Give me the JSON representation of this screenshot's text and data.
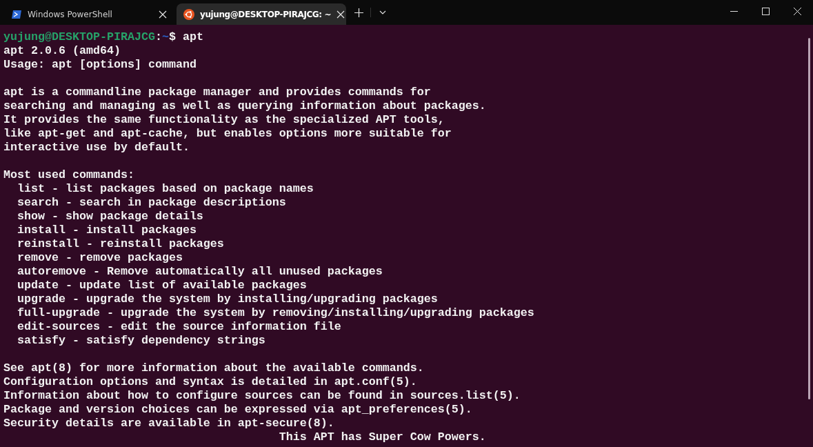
{
  "tabs": [
    {
      "kind": "powershell",
      "title": "Windows PowerShell",
      "selected": false
    },
    {
      "kind": "ubuntu",
      "title": "yujung@DESKTOP-PIRAJCG: ~",
      "selected": true
    }
  ],
  "terminal": {
    "prompt": {
      "user_host": "yujung@DESKTOP-PIRAJCG",
      "separator": ":",
      "path": "~",
      "symbol": "$",
      "command": "apt"
    },
    "blocks": [
      [
        "apt 2.0.6 (amd64)",
        "Usage: apt [options] command"
      ],
      [
        "apt is a commandline package manager and provides commands for",
        "searching and managing as well as querying information about packages.",
        "It provides the same functionality as the specialized APT tools,",
        "like apt-get and apt-cache, but enables options more suitable for",
        "interactive use by default."
      ],
      [
        "Most used commands:",
        "  list - list packages based on package names",
        "  search - search in package descriptions",
        "  show - show package details",
        "  install - install packages",
        "  reinstall - reinstall packages",
        "  remove - remove packages",
        "  autoremove - Remove automatically all unused packages",
        "  update - update list of available packages",
        "  upgrade - upgrade the system by installing/upgrading packages",
        "  full-upgrade - upgrade the system by removing/installing/upgrading packages",
        "  edit-sources - edit the source information file",
        "  satisfy - satisfy dependency strings"
      ],
      [
        "See apt(8) for more information about the available commands.",
        "Configuration options and syntax is detailed in apt.conf(5).",
        "Information about how to configure sources can be found in sources.list(5).",
        "Package and version choices can be expressed via apt_preferences(5).",
        "Security details are available in apt-secure(8).",
        "                                        This APT has Super Cow Powers."
      ]
    ]
  }
}
